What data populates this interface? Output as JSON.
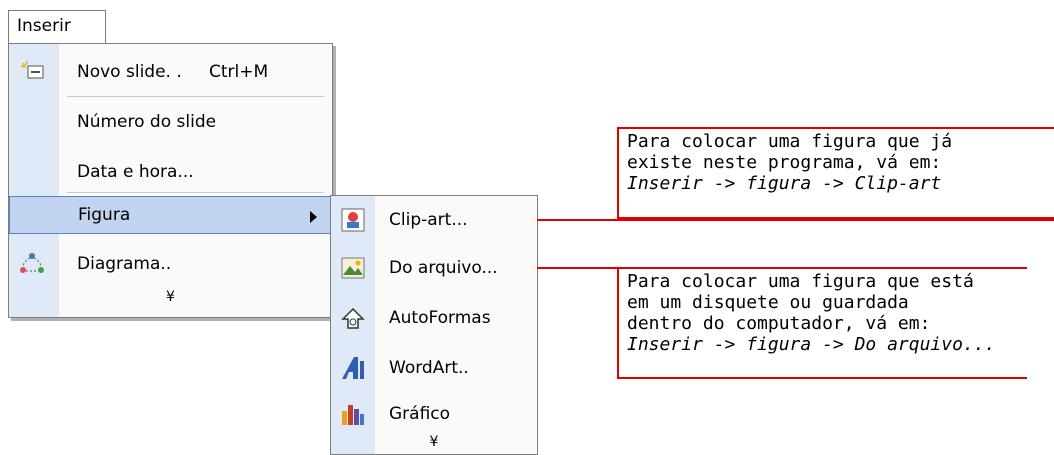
{
  "menu_title": "Inserir",
  "menu": {
    "items": [
      {
        "label": "Novo slide. .",
        "shortcut": "Ctrl+M",
        "icon": "new-slide-icon"
      },
      {
        "label": "Número do slide"
      },
      {
        "label": "Data e hora..."
      },
      {
        "label": "Figura",
        "icon": "submenu-arrow"
      },
      {
        "label": "Diagrama..",
        "icon": "diagram-icon"
      }
    ],
    "more": "¥"
  },
  "submenu": {
    "items": [
      {
        "label": "Clip-art...",
        "icon": "clipart-icon"
      },
      {
        "label": "Do arquivo...",
        "icon": "picture-file-icon"
      },
      {
        "label": "AutoFormas",
        "icon": "autoshapes-icon"
      },
      {
        "label": "WordArt..",
        "icon": "wordart-icon"
      },
      {
        "label": "Gráfico",
        "icon": "chart-icon"
      }
    ],
    "more": "¥"
  },
  "callout1": {
    "line1": "Para colocar uma figura que já",
    "line2": "existe neste programa, vá em:",
    "line3": "Inserir -> figura -> Clip-art"
  },
  "callout2": {
    "line1": "Para colocar uma figura que está",
    "line2": "em um disquete ou guardada",
    "line3": "dentro do computador, vá em:",
    "line4": "Inserir -> figura -> Do arquivo..."
  },
  "colors": {
    "accent": "#e00000",
    "highlight": "#c1d3ee",
    "gutter": "#dfe9f8"
  }
}
